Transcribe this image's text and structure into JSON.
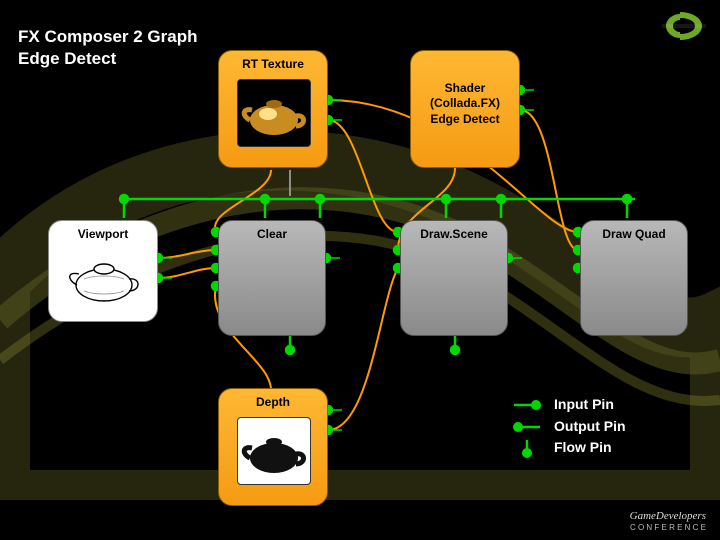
{
  "title": "FX Composer 2 Graph\nEdge Detect",
  "nodes": {
    "rt_texture": "RT Texture",
    "shader": "Shader\n(Collada.FX)\nEdge Detect",
    "viewport": "Viewport",
    "clear": "Clear",
    "draw_scene": "Draw.Scene",
    "draw_quad": "Draw Quad",
    "depth": "Depth"
  },
  "legend": {
    "input_pin": "Input Pin",
    "output_pin": "Output Pin",
    "flow_pin": "Flow Pin"
  },
  "colors": {
    "flow": "#00d800",
    "data": "#ff9a00",
    "misc": "#aaaaaa",
    "node_orange": "#f59b12",
    "node_gray": "#999999",
    "bg": "#000000"
  }
}
